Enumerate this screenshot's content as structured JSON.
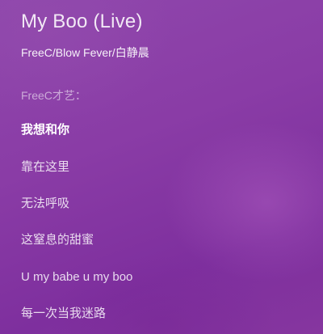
{
  "song": {
    "title": "My Boo (Live)",
    "artist": "FreeC/Blow Fever/白静晨"
  },
  "lyrics": {
    "lines": [
      {
        "text": "FreeC才艺：",
        "state": "credit"
      },
      {
        "text": "我想和你",
        "state": "current"
      },
      {
        "text": "靠在这里",
        "state": "upcoming"
      },
      {
        "text": "无法呼吸",
        "state": "upcoming"
      },
      {
        "text": "这窒息的甜蜜",
        "state": "upcoming"
      },
      {
        "text": "U my babe u my boo",
        "state": "upcoming"
      },
      {
        "text": "每一次当我迷路",
        "state": "upcoming"
      }
    ]
  }
}
